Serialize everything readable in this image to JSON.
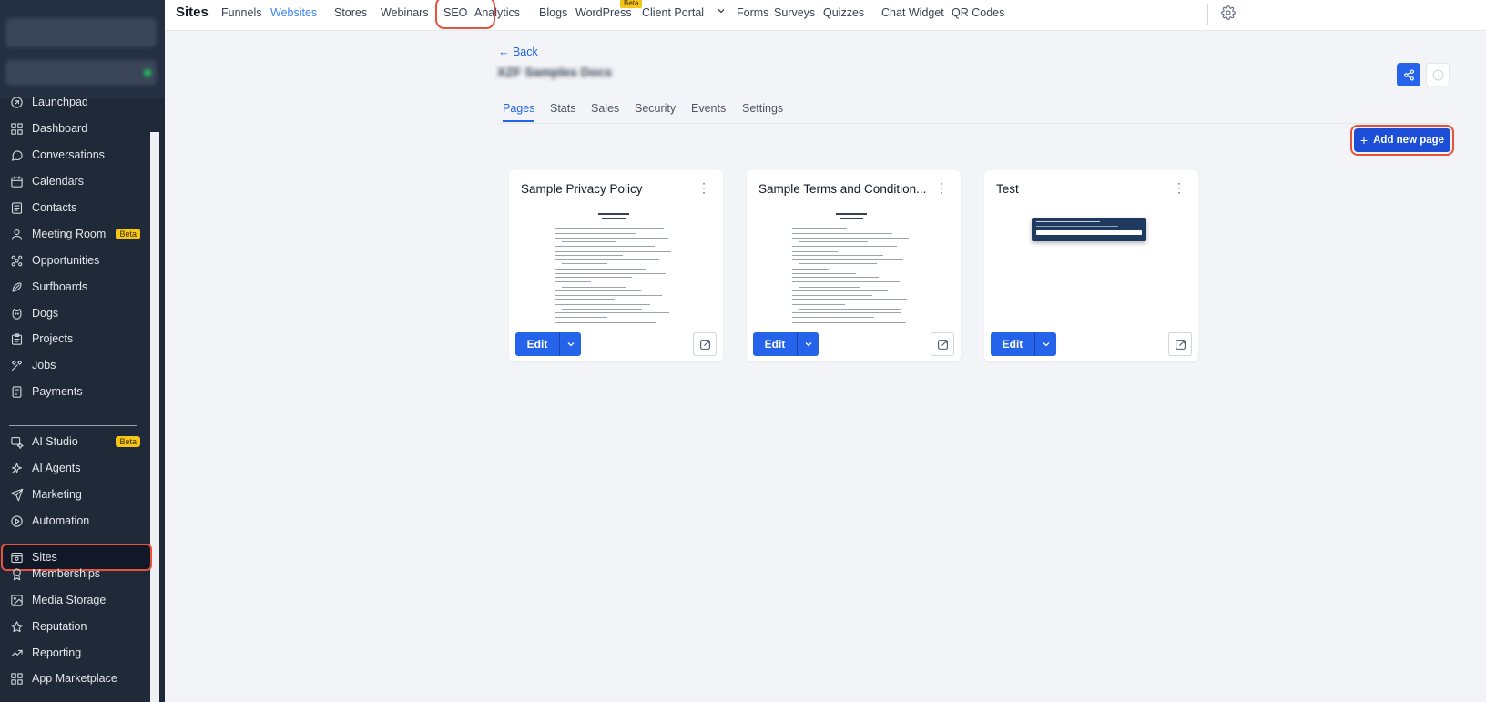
{
  "colors": {
    "sidebar_bg": "#1f2937",
    "accent": "#2563eb",
    "highlight": "#e5533d",
    "beta": "#f5c518"
  },
  "sidebar": {
    "items": [
      {
        "label": "Launchpad",
        "icon": "launchpad-icon"
      },
      {
        "label": "Dashboard",
        "icon": "dashboard-icon"
      },
      {
        "label": "Conversations",
        "icon": "chat-icon"
      },
      {
        "label": "Calendars",
        "icon": "calendar-icon"
      },
      {
        "label": "Contacts",
        "icon": "contacts-icon"
      },
      {
        "label": "Meeting Room",
        "icon": "user-icon",
        "badge": "Beta"
      },
      {
        "label": "Opportunities",
        "icon": "opportunities-icon"
      },
      {
        "label": "Surfboards",
        "icon": "surfboard-icon"
      },
      {
        "label": "Dogs",
        "icon": "dog-icon"
      },
      {
        "label": "Projects",
        "icon": "projects-icon"
      },
      {
        "label": "Jobs",
        "icon": "tools-icon"
      },
      {
        "label": "Payments",
        "icon": "payments-icon"
      },
      {
        "label": "AI Studio",
        "icon": "ai-studio-icon",
        "badge": "Beta"
      },
      {
        "label": "AI Agents",
        "icon": "sparkle-icon"
      },
      {
        "label": "Marketing",
        "icon": "send-icon"
      },
      {
        "label": "Automation",
        "icon": "automation-icon"
      },
      {
        "label": "Sites",
        "icon": "sites-icon",
        "active": true
      },
      {
        "label": "Memberships",
        "icon": "award-icon"
      },
      {
        "label": "Media Storage",
        "icon": "image-icon"
      },
      {
        "label": "Reputation",
        "icon": "star-icon"
      },
      {
        "label": "Reporting",
        "icon": "trend-icon"
      },
      {
        "label": "App Marketplace",
        "icon": "grid-icon"
      }
    ]
  },
  "topnav": {
    "title": "Sites",
    "links": [
      "Funnels",
      "Websites",
      "Stores",
      "Webinars",
      "SEO",
      "Analytics",
      "Blogs",
      "WordPress",
      "Client Portal",
      "Forms",
      "Surveys",
      "Quizzes",
      "Chat Widget",
      "QR Codes"
    ],
    "active": "Websites",
    "seo_badge": "Beta"
  },
  "header": {
    "back_label": "← Back",
    "site_name": "XZF Samples Docs"
  },
  "tabs": [
    "Pages",
    "Stats",
    "Sales",
    "Security",
    "Events",
    "Settings"
  ],
  "add_button_label": "Add new page",
  "cards": [
    {
      "title": "Sample Privacy Policy",
      "edit_label": "Edit",
      "preview": "document"
    },
    {
      "title": "Sample Terms and Condition...",
      "edit_label": "Edit",
      "preview": "document"
    },
    {
      "title": "Test",
      "edit_label": "Edit",
      "preview": "banner"
    }
  ]
}
